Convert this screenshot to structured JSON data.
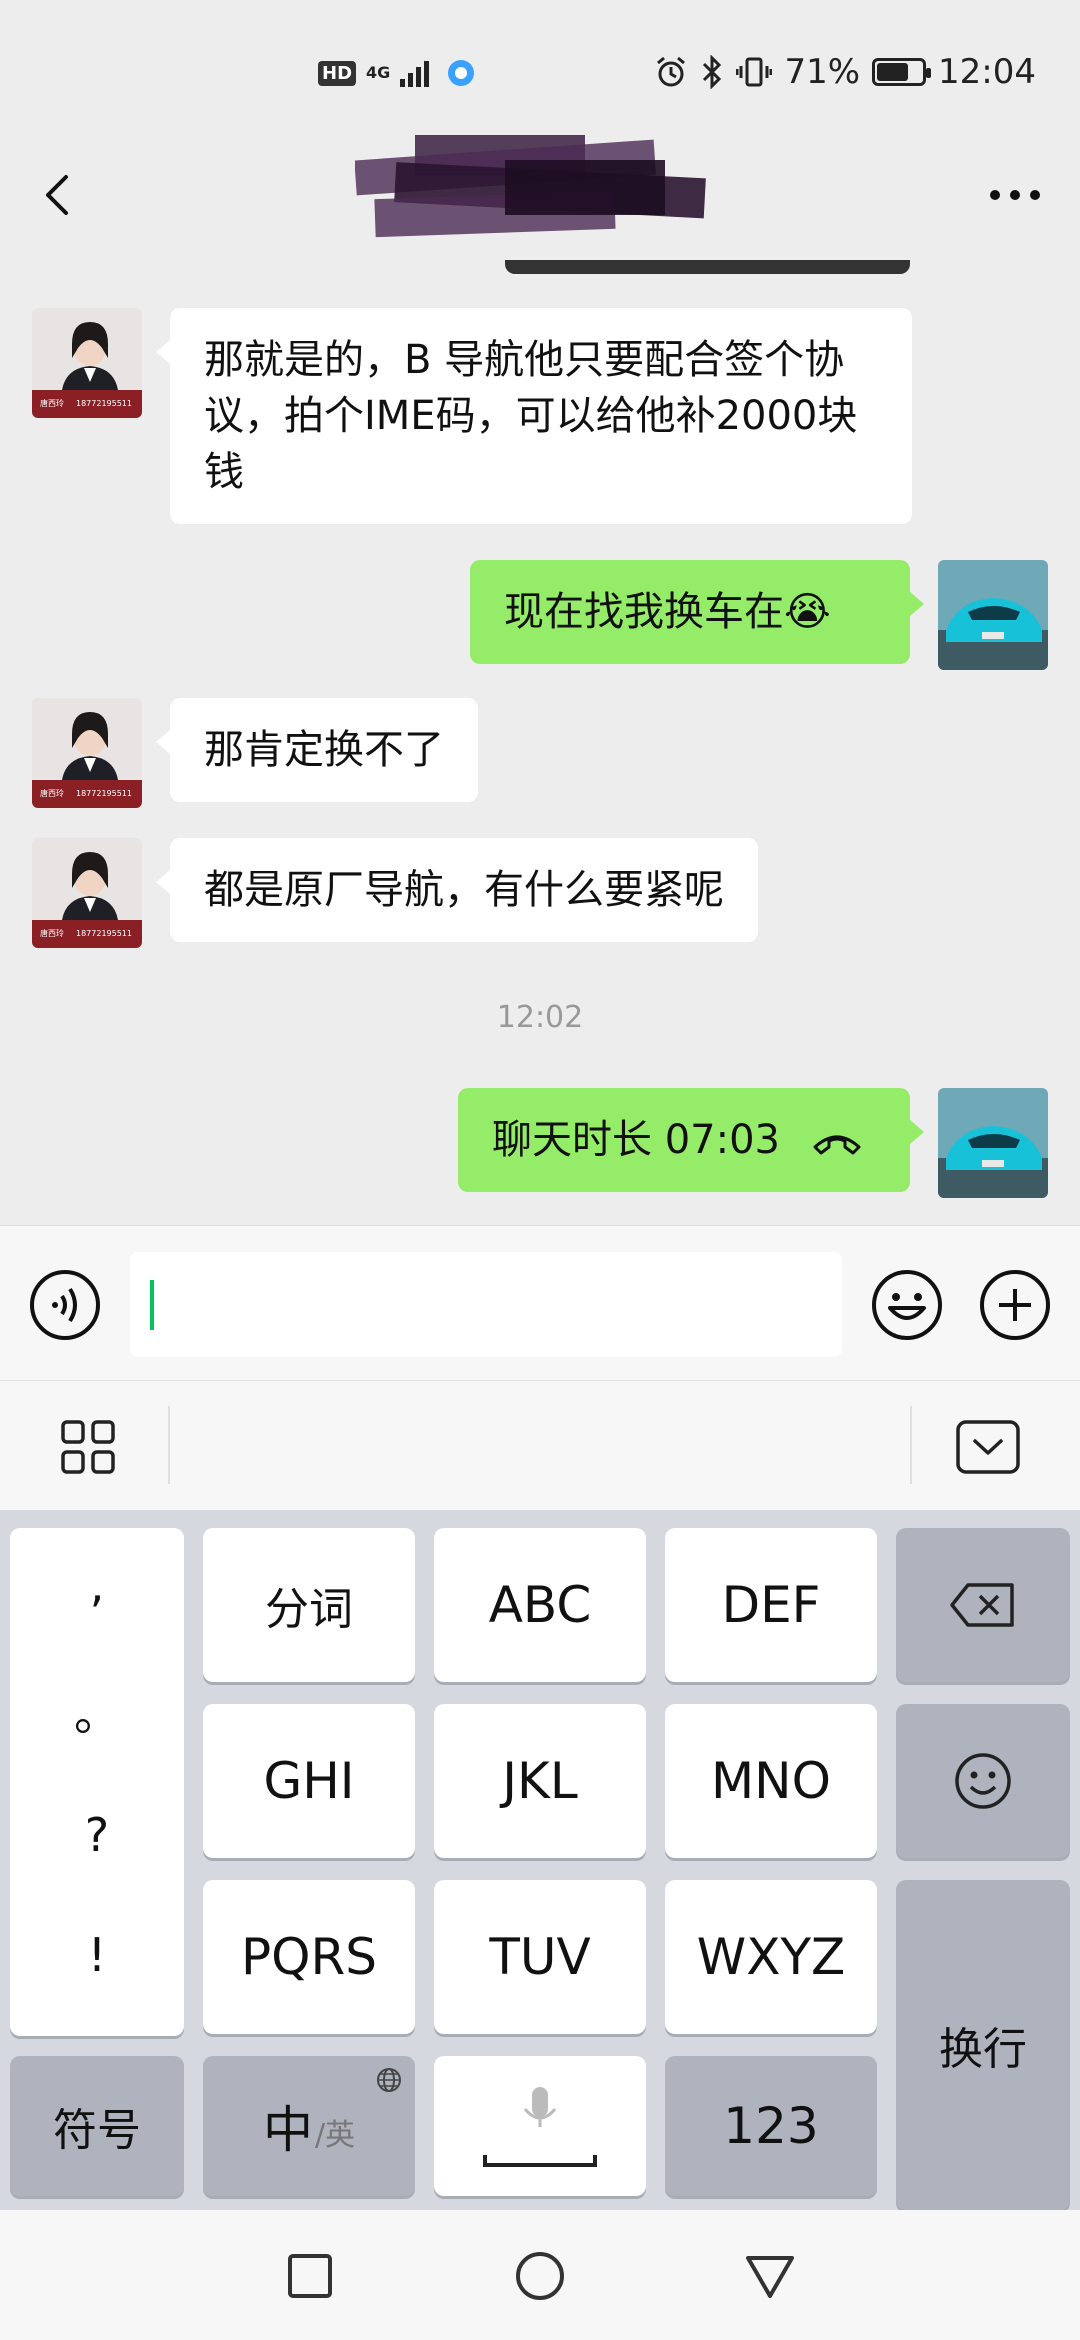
{
  "status_bar": {
    "hd": "HD",
    "network": "4G",
    "battery_text": "71%",
    "battery_level": 0.71,
    "time": "12:04"
  },
  "messages": [
    {
      "side": "left",
      "text": "那就是的，B 导航他只要配合签个协议，拍个IME码，可以给他补2000块钱"
    },
    {
      "side": "right",
      "text": "现在找我换车在😭"
    },
    {
      "side": "left",
      "text": "那肯定换不了"
    },
    {
      "side": "left",
      "text": "都是原厂导航，有什么要紧呢"
    }
  ],
  "timestamp": "12:02",
  "call_message": {
    "text": "聊天时长 07:03"
  },
  "avatar_card": {
    "name": "唐西玲",
    "phone": "18772195511"
  },
  "keyboard": {
    "punct": [
      ",",
      "。",
      "?",
      "!"
    ],
    "row1": [
      "分词",
      "ABC",
      "DEF"
    ],
    "row2": [
      "GHI",
      "JKL",
      "MNO"
    ],
    "row3": [
      "PQRS",
      "TUV",
      "WXYZ"
    ],
    "symbols": "符号",
    "lang_main": "中",
    "lang_sub": "/英",
    "numbers": "123",
    "enter": "换行"
  },
  "colors": {
    "background": "#ededed",
    "bubble_self": "#95ec69",
    "bubble_other": "#ffffff",
    "cursor": "#07c160",
    "keyboard_bg": "#d5d8de"
  },
  "icons": [
    "hd-icon",
    "network-4g-icon",
    "signal-icon",
    "qq-browser-icon",
    "alarm-icon",
    "bluetooth-icon",
    "vibrate-icon",
    "battery-icon",
    "back-icon",
    "more-icon",
    "voice-icon",
    "emoji-icon",
    "plus-icon",
    "apps-grid-icon",
    "hide-keyboard-icon",
    "backspace-icon",
    "emoji-face-icon",
    "microphone-icon",
    "globe-icon",
    "hang-up-icon",
    "recent-apps-icon",
    "home-icon",
    "nav-back-icon"
  ]
}
